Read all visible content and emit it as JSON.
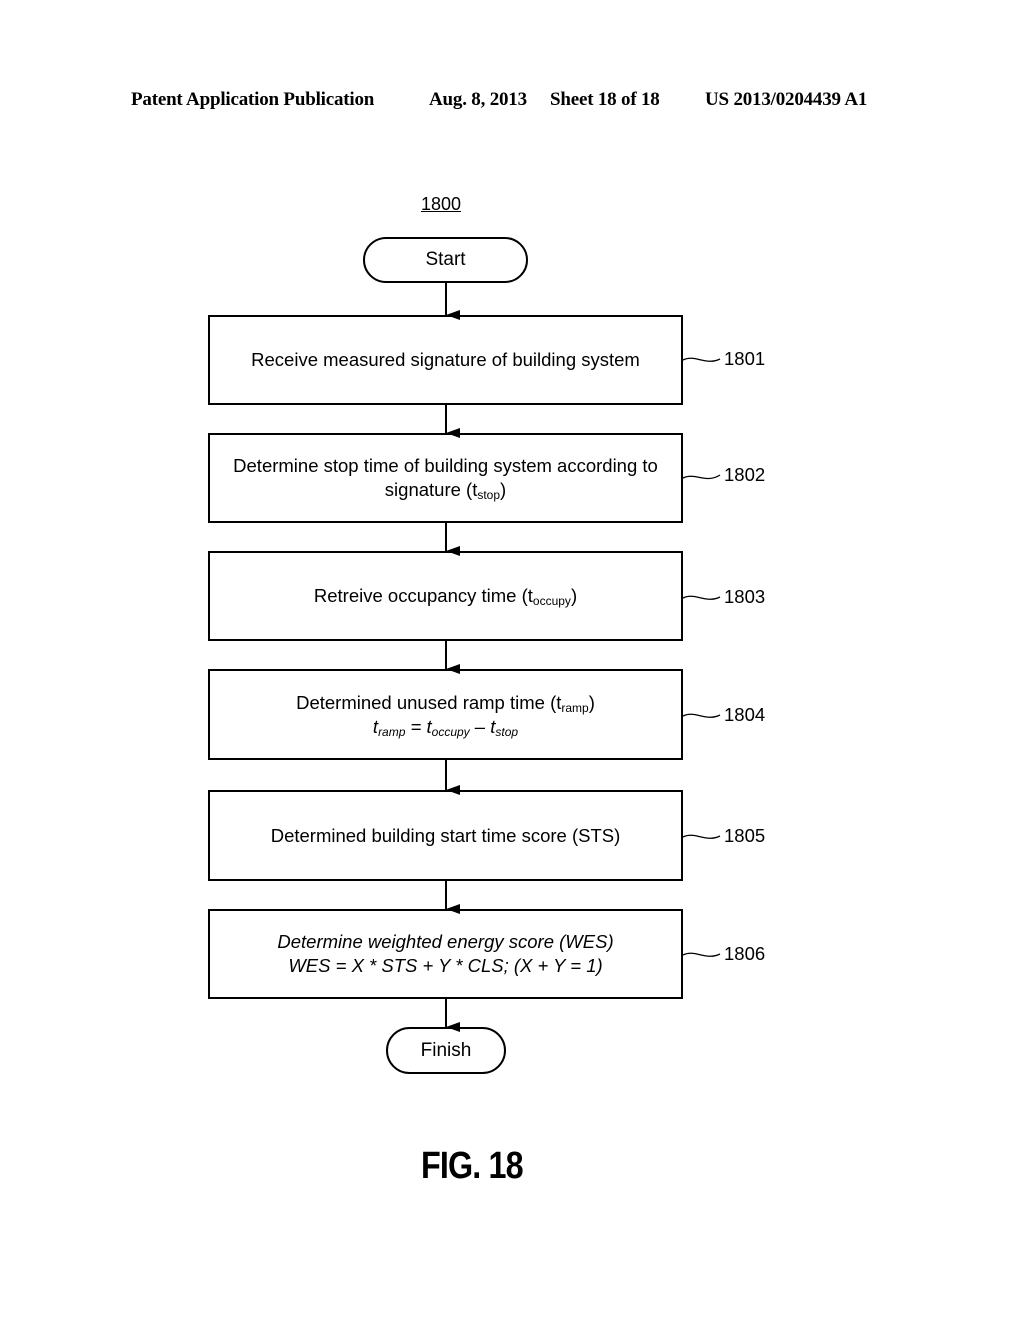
{
  "header": {
    "publication": "Patent Application Publication",
    "date": "Aug. 8, 2013",
    "sheet": "Sheet 18 of 18",
    "number": "US 2013/0204439 A1"
  },
  "diagram": {
    "ref": "1800",
    "start": "Start",
    "finish": "Finish",
    "steps": [
      {
        "id": "1801",
        "text": "Receive measured signature of building system"
      },
      {
        "id": "1802",
        "line1": "Determine stop time of building system according to",
        "line2_pre": "signature (t",
        "line2_sub": "stop",
        "line2_post": ")"
      },
      {
        "id": "1803",
        "pre": "Retreive occupancy time (t",
        "sub": "occupy",
        "post": ")"
      },
      {
        "id": "1804",
        "line1_pre": "Determined unused ramp time (t",
        "line1_sub": "ramp",
        "line1_post": ")",
        "eq_t1": "t",
        "eq_s1": "ramp",
        "eq_mid": " = t",
        "eq_s2": "occupy",
        "eq_minus": " – t",
        "eq_s3": "stop"
      },
      {
        "id": "1805",
        "text": "Determined building start time score (STS)"
      },
      {
        "id": "1806",
        "line1": "Determine weighted energy score (WES)",
        "line2": "WES = X * STS + Y * CLS; (X + Y = 1)"
      }
    ]
  },
  "figure_label": "FIG. 18"
}
